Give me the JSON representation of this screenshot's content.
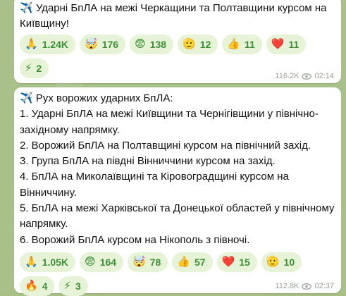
{
  "post1": {
    "text": "✈️ Ударні БпЛА на межі Черкащини та Полтавщини курсом на Київщину!",
    "text_icon": "plane",
    "reactions": [
      {
        "emoji": "🙏",
        "count": "1.24K"
      },
      {
        "emoji": "🤯",
        "count": "176"
      },
      {
        "emoji": "😨",
        "count": "138"
      },
      {
        "emoji": "🫡",
        "count": "12"
      },
      {
        "emoji": "👍",
        "count": "11"
      },
      {
        "emoji": "❤️",
        "count": "11"
      },
      {
        "emoji": "⚡",
        "count": "2"
      }
    ],
    "views": "116.2K",
    "time": "02:14"
  },
  "post2": {
    "lines": [
      "✈️ Рух ворожих ударних БпЛА:",
      "1. Ударні БпЛА на межі Київщини та Чернігівщини у північно-західному напрямку.",
      "2. Ворожий БпЛА на Полтавщині курсом на північний захід.",
      "3. Група БпЛА на півдні Вінниччини курсом на захід.",
      "4. БпЛА на Миколаївщині та Кіровоградщині курсом на Вінниччину.",
      "5. БпЛА на межі Харківської та Донецької областей у північному напрямку.",
      "6. Ворожий БпЛА курсом на Нікополь з півночі."
    ],
    "reactions": [
      {
        "emoji": "🙏",
        "count": "1.05K"
      },
      {
        "emoji": "😨",
        "count": "164"
      },
      {
        "emoji": "🤯",
        "count": "78"
      },
      {
        "emoji": "👍",
        "count": "57"
      },
      {
        "emoji": "❤️",
        "count": "15"
      },
      {
        "emoji": "🫡",
        "count": "10"
      },
      {
        "emoji": "🔥",
        "count": "4"
      },
      {
        "emoji": "⚡",
        "count": "3"
      }
    ],
    "views": "112.8K",
    "time": "02:37"
  },
  "colors": {
    "reaction_bg": "#e6f3d7",
    "reaction_text": "#3e8f38",
    "meta_text": "#9aa39a",
    "bubble": "#ffffff"
  }
}
